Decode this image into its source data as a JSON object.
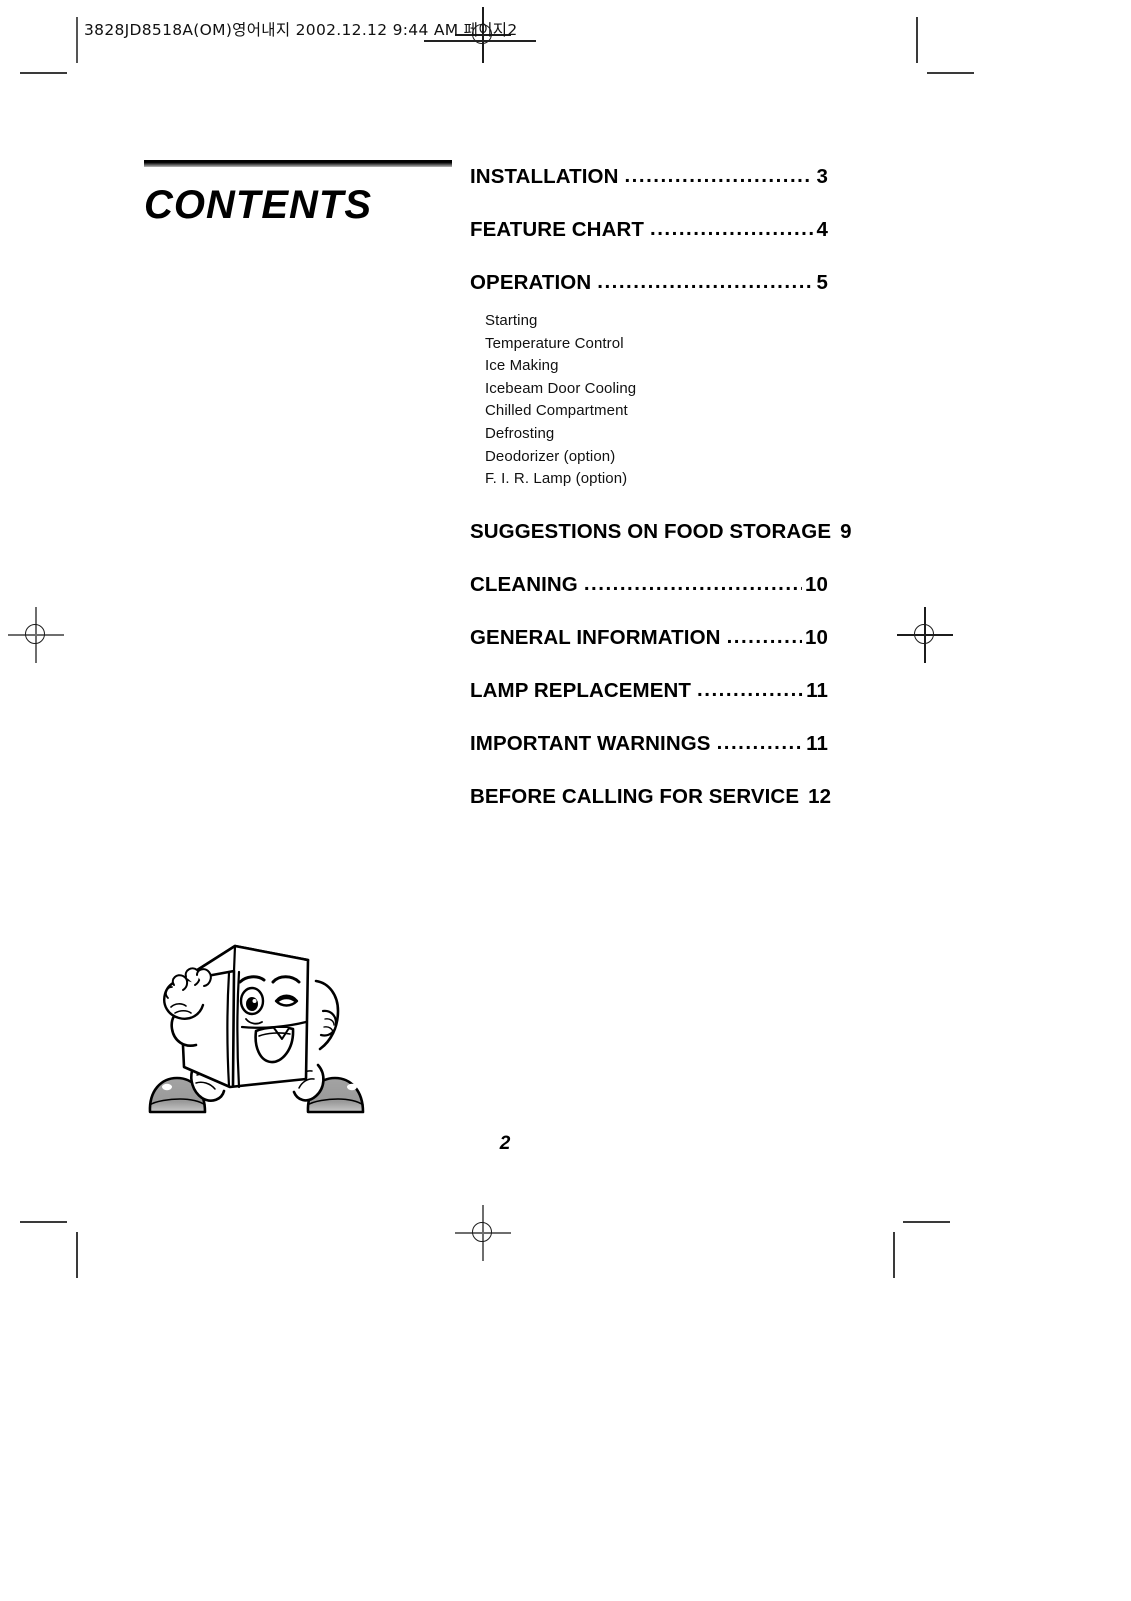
{
  "page": {
    "slug": "3828JD8518A(OM)영어내지  2002.12.12 9:44 AM  페이지2",
    "folio": "2"
  },
  "title": {
    "heading": "CONTENTS"
  },
  "toc": {
    "leader_dots": "..............................................................................",
    "entries": [
      {
        "label": "INSTALLATION",
        "page": "3"
      },
      {
        "label": "FEATURE CHART",
        "page": "4"
      },
      {
        "label": "OPERATION",
        "page": "5"
      },
      {
        "label": "SUGGESTIONS ON FOOD STORAGE",
        "page": "9"
      },
      {
        "label": "CLEANING",
        "page": "10"
      },
      {
        "label": "GENERAL INFORMATION",
        "page": "10"
      },
      {
        "label": "LAMP REPLACEMENT",
        "page": "11"
      },
      {
        "label": "IMPORTANT WARNINGS",
        "page": "11"
      },
      {
        "label": "BEFORE CALLING FOR SERVICE",
        "page": "12"
      }
    ],
    "operation_subitems": [
      "Starting",
      "Temperature Control",
      "Ice Making",
      "Icebeam Door Cooling",
      "Chilled Compartment",
      "Defrosting",
      "Deodorizer (option)",
      "F. I. R. Lamp (option)"
    ]
  },
  "illustration": {
    "name": "refrigerator-mascot",
    "description": "Cartoon refrigerator character winking and waving",
    "body_fill": "#ffffff",
    "shoe_fill": "#9a9a9a",
    "outline": "#000000"
  }
}
